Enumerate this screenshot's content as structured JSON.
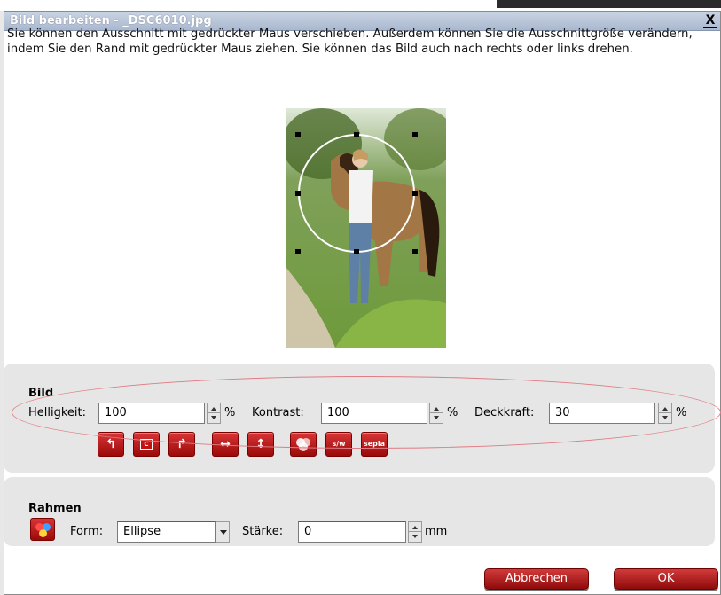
{
  "window": {
    "title": "Bild bearbeiten - _DSC6010.jpg",
    "close_label": "X"
  },
  "instructions": "Sie können den Ausschnitt mit gedrückter Maus verschieben. Außerdem können Sie die Ausschnittgröße verändern, indem Sie den Rand mit gedrückter Maus ziehen. Sie können das Bild auch nach rechts oder links drehen.",
  "bild": {
    "title": "Bild",
    "helligkeit_label": "Helligkeit:",
    "helligkeit_value": "100",
    "kontrast_label": "Kontrast:",
    "kontrast_value": "100",
    "deckkraft_label": "Deckkraft:",
    "deckkraft_value": "30",
    "unit": "%",
    "tools": {
      "c_label": "C",
      "sw_label": "s/w",
      "sepia_label": "sepia"
    }
  },
  "rahmen": {
    "title": "Rahmen",
    "form_label": "Form:",
    "form_value": "Ellipse",
    "staerke_label": "Stärke:",
    "staerke_value": "0",
    "staerke_unit": "mm"
  },
  "buttons": {
    "cancel": "Abbrechen",
    "ok": "OK"
  },
  "colors": {
    "accent": "#b31414",
    "panel": "#e6e6e6",
    "annotation": "#e07b84"
  }
}
